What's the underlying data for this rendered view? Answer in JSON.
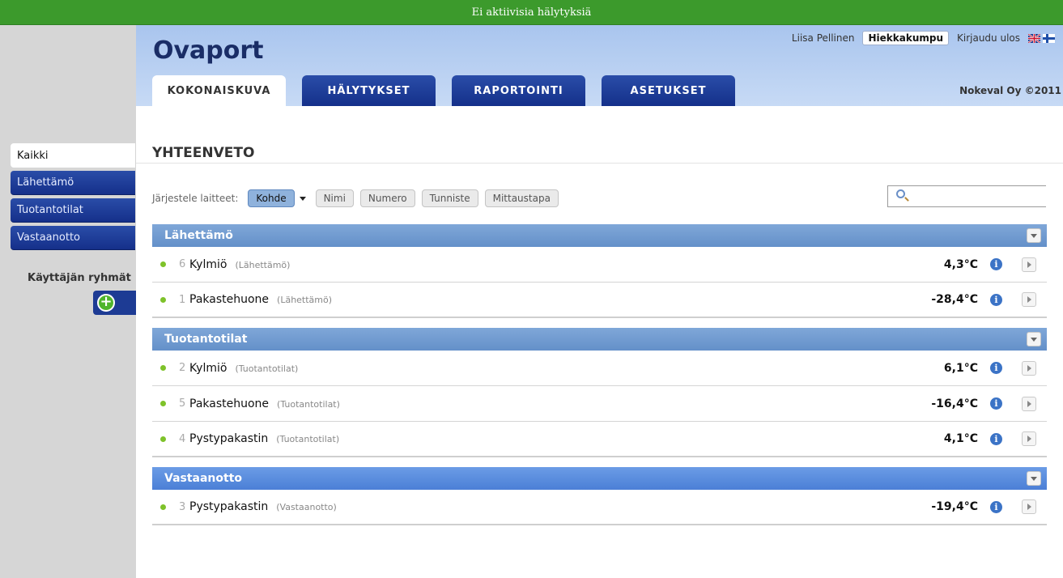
{
  "alarm_bar": {
    "text": "Ei aktiivisia hälytyksiä"
  },
  "header": {
    "logo": "Ovaport",
    "user_name": "Liisa Pellinen",
    "location": "Hiekkakumpu",
    "logout": "Kirjaudu ulos",
    "company": "Nokeval Oy ©2011",
    "tabs": [
      {
        "label": "KOKONAISKUVA"
      },
      {
        "label": "HÄLYTYKSET"
      },
      {
        "label": "RAPORTOINTI"
      },
      {
        "label": "ASETUKSET"
      }
    ]
  },
  "sidebar": {
    "items": [
      {
        "label": "Kaikki"
      },
      {
        "label": "Lähettämö"
      },
      {
        "label": "Tuotantotilat"
      },
      {
        "label": "Vastaanotto"
      }
    ],
    "groups_label": "Käyttäjän ryhmät"
  },
  "main": {
    "title": "YHTEENVETO",
    "sort_label": "Järjestele laitteet:",
    "sort_options": [
      "Kohde",
      "Nimi",
      "Numero",
      "Tunniste",
      "Mittaustapa"
    ],
    "groups": [
      {
        "name": "Lähettämö",
        "rows": [
          {
            "num": "6",
            "name": "Kylmiö",
            "location": "(Lähettämö)",
            "value": "4,3°C"
          },
          {
            "num": "1",
            "name": "Pakastehuone",
            "location": "(Lähettämö)",
            "value": "-28,4°C"
          }
        ]
      },
      {
        "name": "Tuotantotilat",
        "rows": [
          {
            "num": "2",
            "name": "Kylmiö",
            "location": "(Tuotantotilat)",
            "value": "6,1°C"
          },
          {
            "num": "5",
            "name": "Pakastehuone",
            "location": "(Tuotantotilat)",
            "value": "-16,4°C"
          },
          {
            "num": "4",
            "name": "Pystypakastin",
            "location": "(Tuotantotilat)",
            "value": "4,1°C"
          }
        ]
      },
      {
        "name": "Vastaanotto",
        "rows": [
          {
            "num": "3",
            "name": "Pystypakastin",
            "location": "(Vastaanotto)",
            "value": "-19,4°C"
          }
        ]
      }
    ]
  },
  "colors": {
    "alarm_bar": "#3c9a2c",
    "nav_dark": "#1d3b94",
    "group_header": "#7fa7d8",
    "status_ok": "#7ec22a"
  }
}
